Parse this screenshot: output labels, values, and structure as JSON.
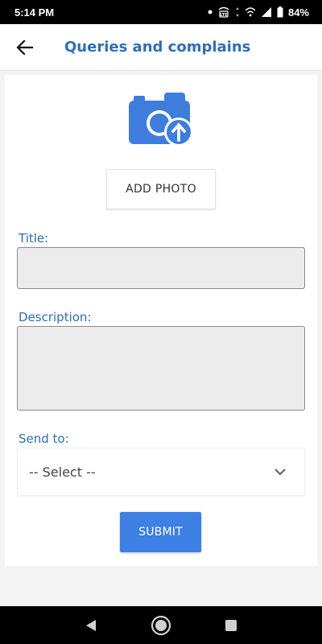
{
  "status_bar": {
    "time": "5:14 PM",
    "battery": "84%",
    "icons": [
      "notification-dot-icon",
      "volte-icon",
      "data-arrows-icon",
      "wifi-icon",
      "signal-icon",
      "battery-icon"
    ]
  },
  "app_bar": {
    "title": "Queries and complains",
    "back_icon": "arrow-left-icon"
  },
  "form": {
    "camera_icon": "camera-upload-icon",
    "add_photo_label": "ADD PHOTO",
    "title_label": "Title:",
    "title_value": "",
    "description_label": "Description:",
    "description_value": "",
    "send_to_label": "Send to:",
    "send_to_selected": "-- Select --",
    "submit_label": "SUBMIT"
  },
  "colors": {
    "accent": "#2f6fb4",
    "button": "#3e80e4",
    "field_bg": "#ececec",
    "page_bg": "#f3f3f3"
  },
  "nav_bar": {
    "icons": [
      "back-triangle-icon",
      "home-circle-icon",
      "recents-square-icon"
    ]
  }
}
